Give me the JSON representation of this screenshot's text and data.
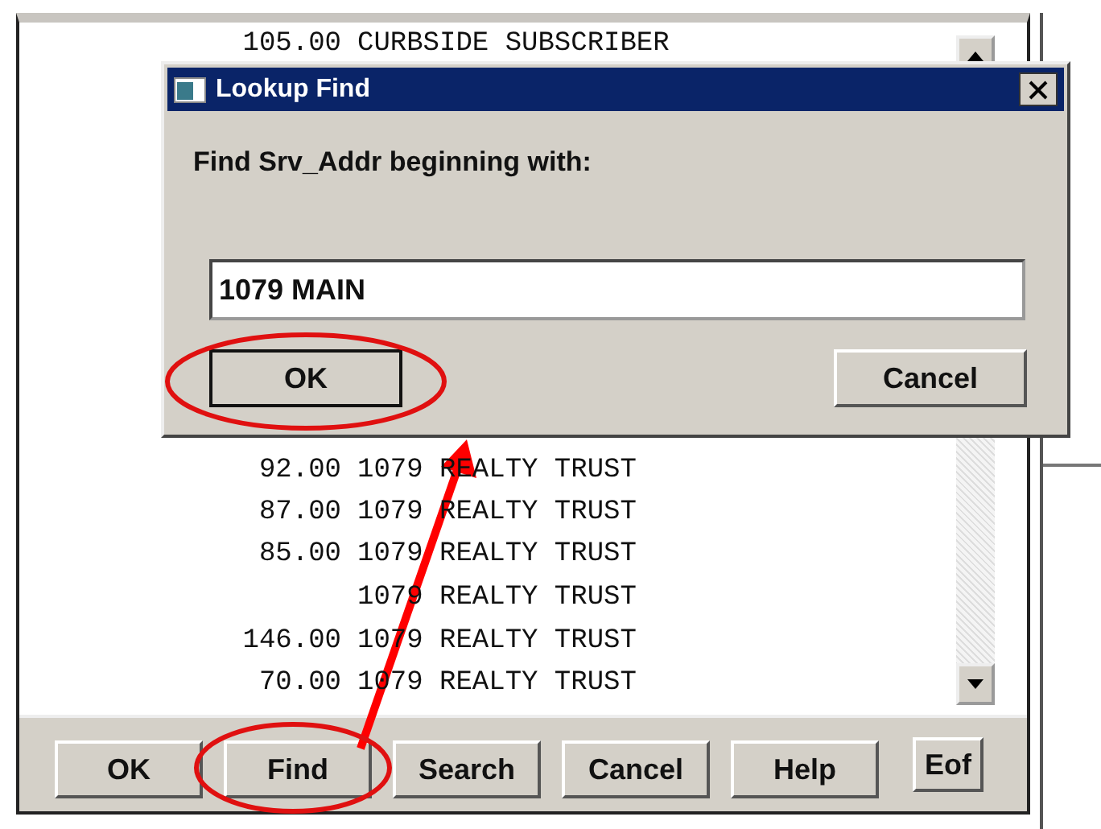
{
  "list": {
    "top_rows": [
      {
        "amount": "105.00",
        "name": "CURBSIDE SUBSCRIBER"
      }
    ],
    "bottom_rows": [
      {
        "amount": "92.00",
        "name": "1079 REALTY TRUST"
      },
      {
        "amount": "87.00",
        "name": "1079 REALTY TRUST"
      },
      {
        "amount": "85.00",
        "name": "1079 REALTY TRUST"
      },
      {
        "amount": "",
        "name": "1079 REALTY TRUST"
      },
      {
        "amount": "146.00",
        "name": "1079 REALTY TRUST"
      },
      {
        "amount": "70.00",
        "name": "1079 REALTY TRUST"
      }
    ]
  },
  "buttons": [
    {
      "label": "OK"
    },
    {
      "label": "Find"
    },
    {
      "label": "Search"
    },
    {
      "label": "Cancel"
    },
    {
      "label": "Help"
    },
    {
      "label": "Eof"
    }
  ],
  "dialog": {
    "title": "Lookup Find",
    "prompt": "Find Srv_Addr beginning with:",
    "input": {
      "value": "1079 MAIN"
    },
    "buttons": [
      {
        "label": "OK",
        "default": true
      },
      {
        "label": "Cancel",
        "default": false
      }
    ]
  }
}
